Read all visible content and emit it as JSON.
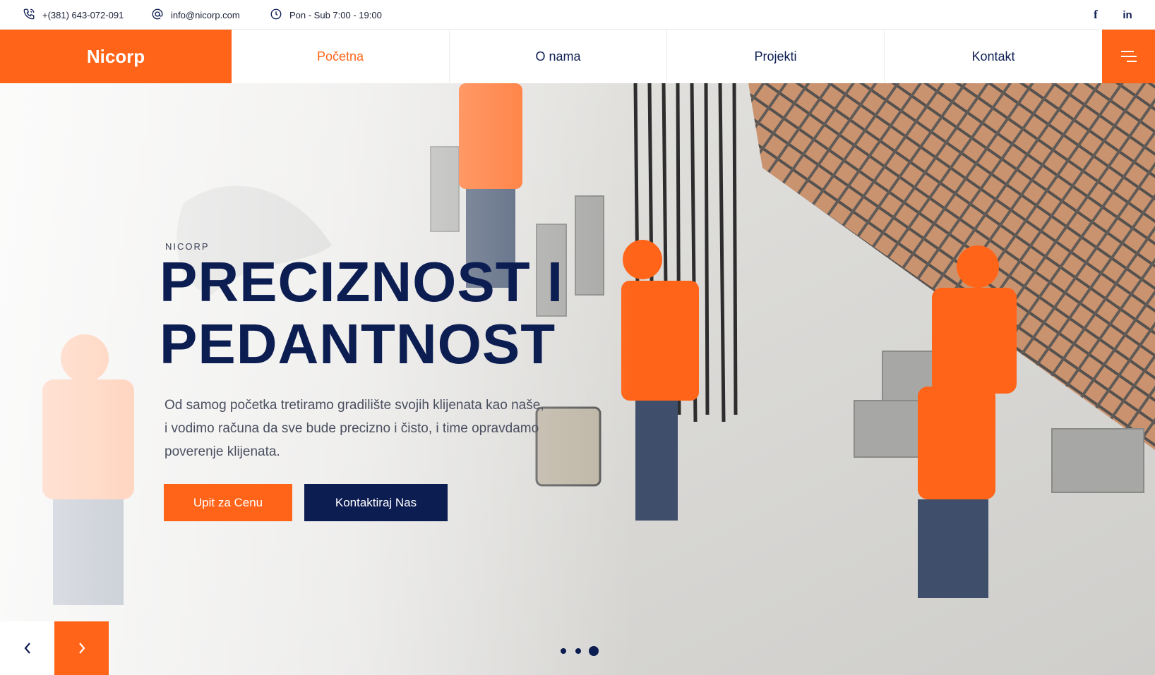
{
  "topbar": {
    "phone": "+(381) 643-072-091",
    "email": "info@nicorp.com",
    "hours": "Pon - Sub 7:00 - 19:00",
    "social": [
      "f",
      "in"
    ]
  },
  "nav": {
    "logo": "Nicorp",
    "items": [
      {
        "label": "Početna",
        "active": true
      },
      {
        "label": "O nama",
        "active": false
      },
      {
        "label": "Projekti",
        "active": false
      },
      {
        "label": "Kontakt",
        "active": false
      }
    ]
  },
  "hero": {
    "eyebrow": "NICORP",
    "headline_line1": "PRECIZNOST I",
    "headline_line2": "PEDANTNOST",
    "description": "Od samog početka tretiramo gradilište svojih klijenata kao naše, i vodimo računa da sve bude precizno i čisto, i time opravdamo poverenje klijenata.",
    "btn_primary": "Upit za Cenu",
    "btn_secondary": "Kontaktiraj Nas",
    "slides_count": 3,
    "active_slide": 3
  },
  "colors": {
    "accent": "#ff6418",
    "navy": "#0c1d52"
  },
  "icons": [
    "phone-icon",
    "at-icon",
    "clock-icon",
    "facebook-icon",
    "linkedin-icon",
    "menu-icon",
    "chevron-left-icon",
    "chevron-right-icon"
  ]
}
